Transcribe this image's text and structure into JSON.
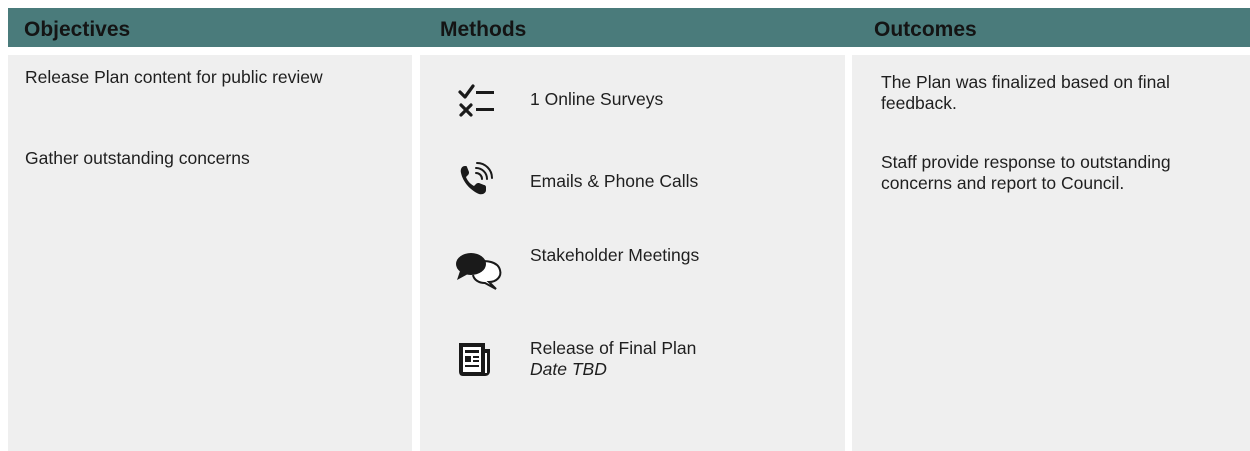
{
  "headers": {
    "objectives": "Objectives",
    "methods": "Methods",
    "outcomes": "Outcomes"
  },
  "objectives": [
    "Release Plan content for public review",
    "Gather outstanding concerns"
  ],
  "methods": [
    {
      "icon": "checklist-icon",
      "label": "1 Online Surveys"
    },
    {
      "icon": "phone-call-icon",
      "label": "Emails & Phone Calls"
    },
    {
      "icon": "chat-bubbles-icon",
      "label": "Stakeholder Meetings"
    },
    {
      "icon": "document-release-icon",
      "label": "Release of Final Plan",
      "sublabel": "Date TBD"
    }
  ],
  "outcomes": [
    "The Plan was finalized based on final feedback.",
    "Staff provide response to outstanding concerns and report to Council."
  ],
  "colors": {
    "header_bg": "#4a7b7b",
    "column_bg": "#efefef",
    "text": "#1f1f1f"
  }
}
